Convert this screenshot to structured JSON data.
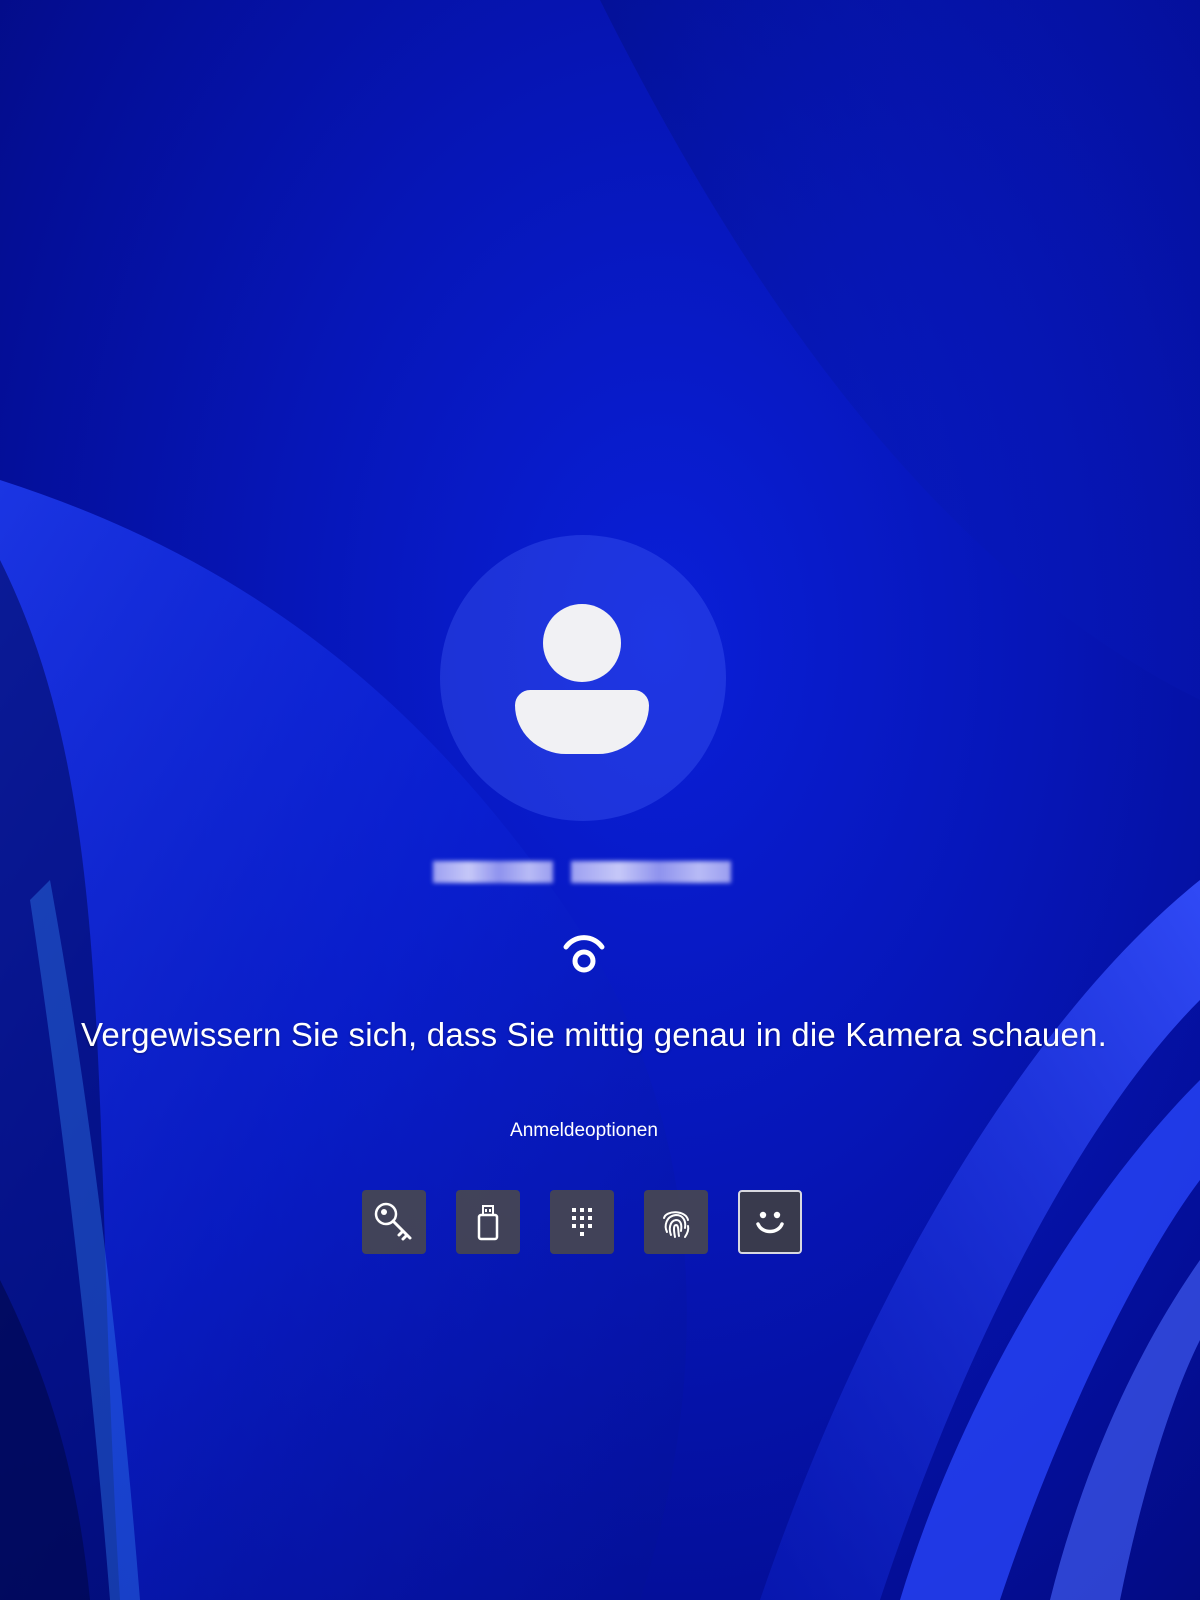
{
  "login": {
    "username": "",
    "face_scan_icon": "face-recognition-icon",
    "instruction": "Vergewissern Sie sich, dass Sie mittig genau in die Kamera schauen.",
    "sign_in_options_label": "Anmeldeoptionen",
    "sign_in_options": [
      {
        "name": "password-key",
        "icon": "key-icon",
        "selected": false
      },
      {
        "name": "security-key",
        "icon": "usb-key-icon",
        "selected": false
      },
      {
        "name": "pin",
        "icon": "keypad-icon",
        "selected": false
      },
      {
        "name": "fingerprint",
        "icon": "fingerprint-icon",
        "selected": false
      },
      {
        "name": "facial-recognition",
        "icon": "smiley-face-icon",
        "selected": true
      }
    ]
  },
  "colors": {
    "background": "#0616b8",
    "text": "#ffffff",
    "option_tile": "#464650",
    "avatar": "#f1f1f4"
  }
}
